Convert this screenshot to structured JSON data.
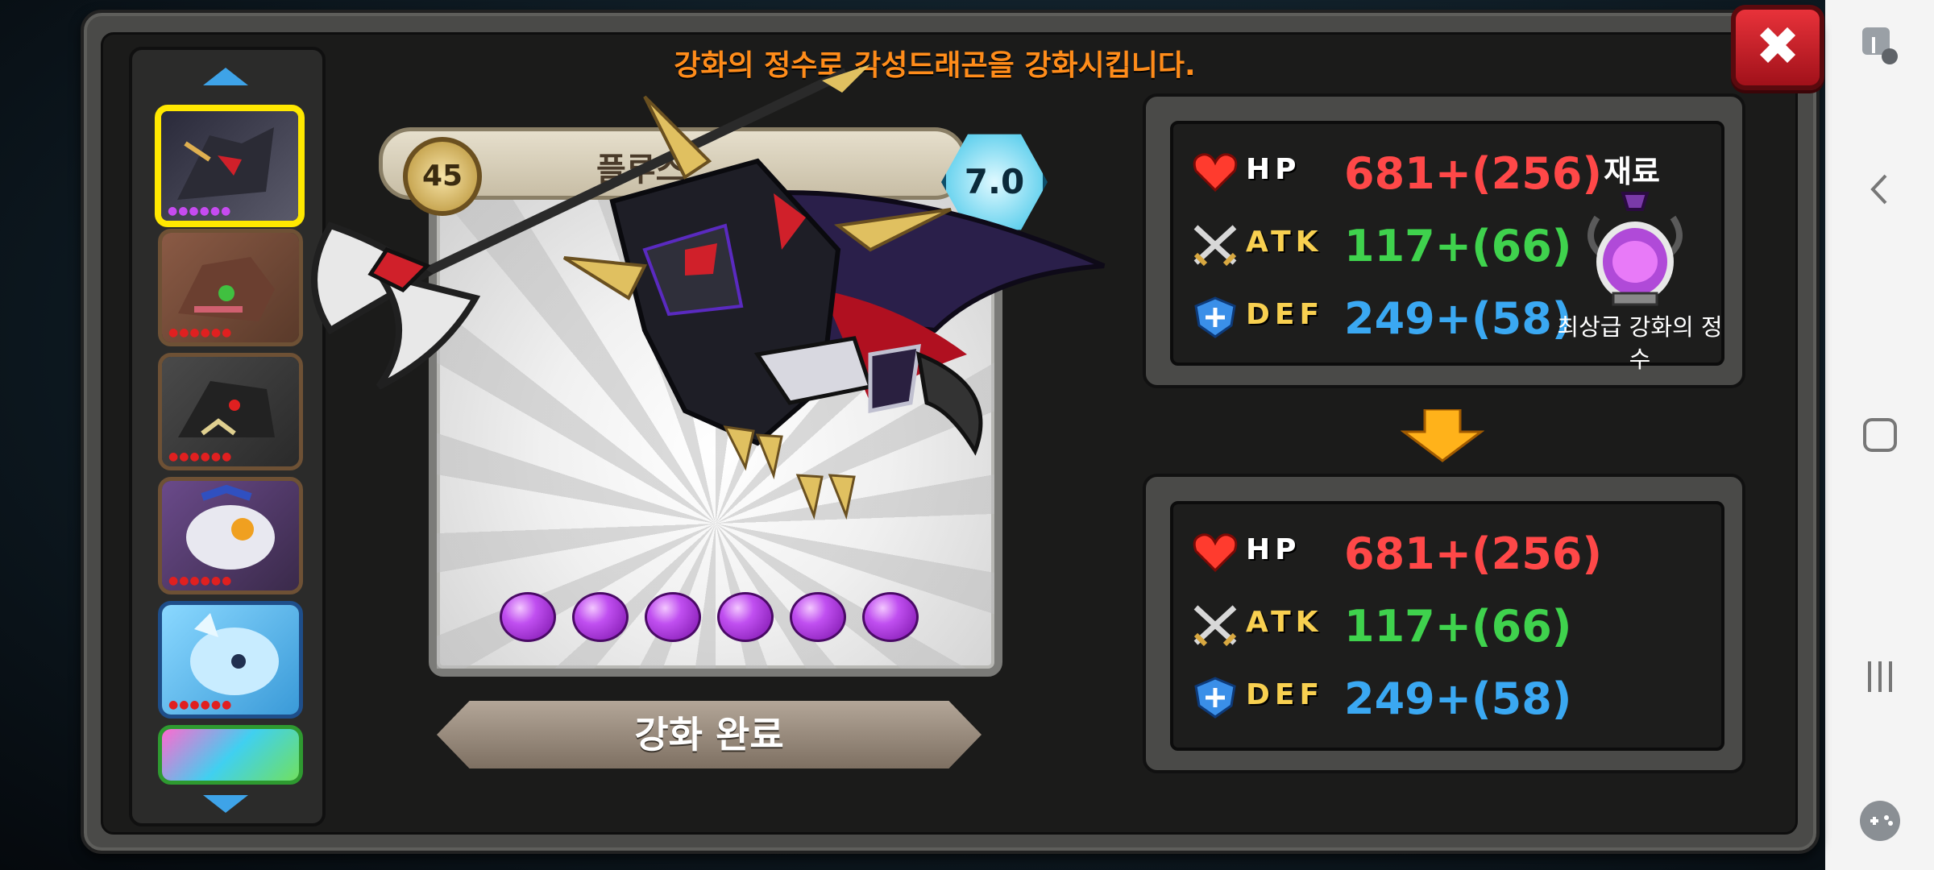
{
  "header": {
    "title": "강화의 정수로 각성드래곤을 강화시킵니다."
  },
  "close_label": "✖",
  "card": {
    "level": "45",
    "grade": "7.0",
    "name": "플루스",
    "orbs_count": 6
  },
  "complete_button": "강화 완료",
  "current_stats": {
    "hp_label": "HP",
    "hp": "681+(256)",
    "atk_label": "ATK",
    "atk": "117+(66)",
    "def_label": "DEF",
    "def": "249+(58)"
  },
  "material": {
    "title": "재료",
    "name": "최상급 강화의 정수"
  },
  "result_stats": {
    "hp_label": "HP",
    "hp": "681+(256)",
    "atk_label": "ATK",
    "atk": "117+(66)",
    "def_label": "DEF",
    "def": "249+(58)"
  },
  "dragon_list": [
    {
      "stars_color": "#c64bf0",
      "bg": "#3b3b4a"
    },
    {
      "stars_color": "#e02020",
      "bg": "#7a4a3a"
    },
    {
      "stars_color": "#e02020",
      "bg": "#3a3a3a"
    },
    {
      "stars_color": "#e02020",
      "bg": "#5a3a6a"
    },
    {
      "stars_color": "#e02020",
      "bg": "#5fb8e8"
    },
    {
      "stars_color": "#e02020",
      "bg": "#6fd06a"
    }
  ],
  "colors": {
    "title": "#ff8c1a",
    "hp": "#ff4848",
    "atk": "#3fd24d",
    "def": "#3aa8f2"
  }
}
